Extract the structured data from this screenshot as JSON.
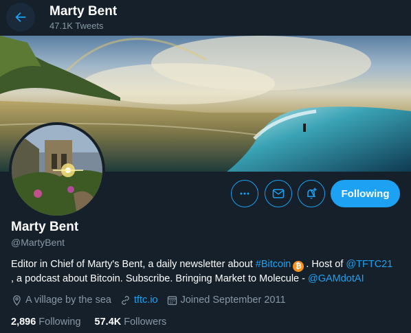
{
  "header": {
    "back_icon": "arrow-left-icon",
    "name": "Marty Bent",
    "tweet_count": "47.1K Tweets"
  },
  "actions": {
    "more_icon": "more-horizontal-icon",
    "message_icon": "envelope-icon",
    "notify_icon": "bell-plus-icon",
    "following_label": "Following"
  },
  "profile": {
    "name": "Marty Bent",
    "handle": "@MartyBent",
    "bio": {
      "part1": "Editor in Chief of Marty's Bent, a daily newsletter about ",
      "hashtag": "#Bitcoin",
      "emoji": "₿",
      "part2": ". Host of ",
      "mention1": "@TFTC21",
      "part3": ", a podcast about Bitcoin. Subscribe. Bringing Market to Molecule - ",
      "mention2": "@GAMdotAI"
    },
    "location": "A village by the sea",
    "website": "tftc.io",
    "joined": "Joined September 2011",
    "following_count": "2,896",
    "following_label": "Following",
    "followers_count": "57.4K",
    "followers_label": "Followers"
  },
  "colors": {
    "background": "#15202b",
    "accent": "#1da1f2",
    "muted": "#8899a6",
    "bitcoin": "#f7931a"
  }
}
